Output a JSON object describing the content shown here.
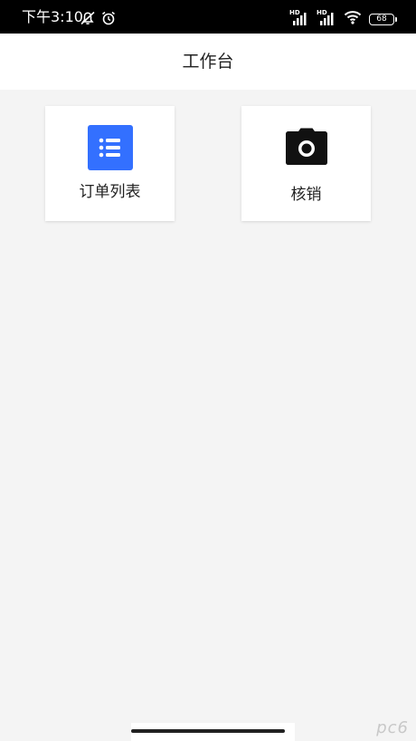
{
  "status_bar": {
    "time": "下午3:10",
    "hd1": "HD",
    "hd2": "HD",
    "battery": "68"
  },
  "header": {
    "title": "工作台"
  },
  "cards": [
    {
      "label": "订单列表",
      "icon": "list-icon",
      "accent": "#3370ff"
    },
    {
      "label": "核销",
      "icon": "camera-icon",
      "accent": "#111111"
    }
  ],
  "watermark": "pc6"
}
